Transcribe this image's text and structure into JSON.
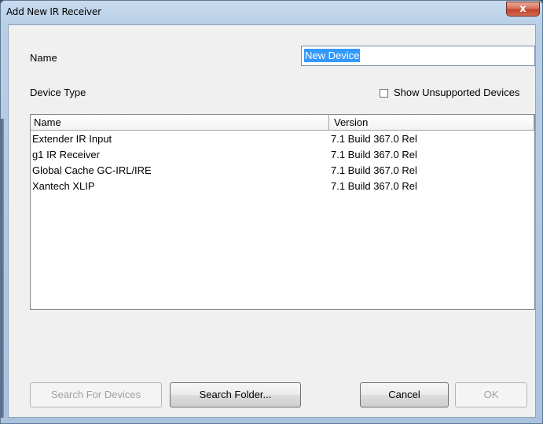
{
  "window": {
    "title": "Add New IR Receiver",
    "close_glyph": "x"
  },
  "form": {
    "name_label": "Name",
    "name_value": "New Device",
    "device_type_label": "Device Type",
    "show_unsupported_label": "Show Unsupported Devices",
    "show_unsupported_checked": false
  },
  "list": {
    "columns": [
      "Name",
      "Version"
    ],
    "rows": [
      {
        "name": "Extender IR Input",
        "version": "7.1 Build 367.0 Rel"
      },
      {
        "name": "g1 IR Receiver",
        "version": "7.1 Build 367.0 Rel"
      },
      {
        "name": "Global Cache GC-IRL/IRE",
        "version": "7.1 Build 367.0 Rel"
      },
      {
        "name": "Xantech XLIP",
        "version": "7.1 Build 367.0 Rel"
      }
    ]
  },
  "buttons": {
    "search_devices": "Search For Devices",
    "search_folder": "Search Folder...",
    "cancel": "Cancel",
    "ok": "OK"
  },
  "icons": {
    "close": "close-icon",
    "checkbox": "checkbox-icon"
  },
  "colors": {
    "selection": "#3399ff",
    "close_button": "#c4432b",
    "titlebar": "#b8cfe6"
  }
}
